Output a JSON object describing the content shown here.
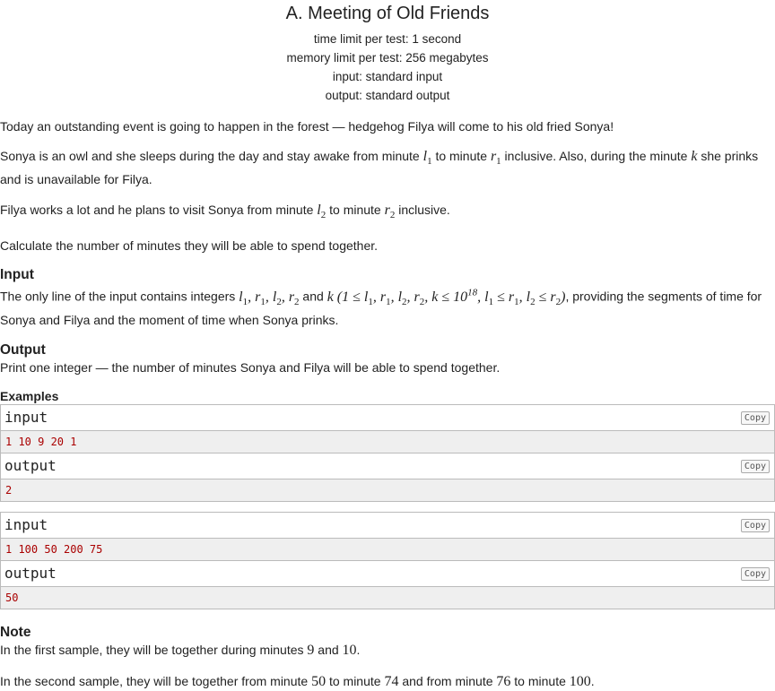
{
  "problem": {
    "title": "A. Meeting of Old Friends",
    "limits": [
      "time limit per test: 1 second",
      "memory limit per test: 256 megabytes",
      "input: standard input",
      "output: standard output"
    ]
  },
  "statement": {
    "p1": "Today an outstanding event is going to happen in the forest — hedgehog Filya will come to his old fried Sonya!",
    "p2": {
      "a": "Sonya is an owl and she sleeps during the day and stay awake from minute ",
      "b": " to minute ",
      "c": " inclusive. Also, during the minute ",
      "d": " she prinks and is unavailable for Filya."
    },
    "p3": {
      "a": "Filya works a lot and he plans to visit Sonya from minute ",
      "b": " to minute ",
      "c": " inclusive."
    },
    "p4": "Calculate the number of minutes they will be able to spend together."
  },
  "input_section": {
    "title": "Input",
    "a": "The only line of the input contains integers ",
    "b": " and ",
    "c": ", providing the segments of time for Sonya and Filya and the moment of time when Sonya prinks."
  },
  "output_section": {
    "title": "Output",
    "text": "Print one integer — the number of minutes Sonya and Filya will be able to spend together."
  },
  "examples": {
    "title": "Examples",
    "copy_label": "Copy",
    "input_label": "input",
    "output_label": "output",
    "ex1_input": "1 10 9 20 1",
    "ex1_output": "2",
    "ex2_input": "1 100 50 200 75",
    "ex2_output": "50"
  },
  "note": {
    "title": "Note",
    "s1": {
      "a": "In the first sample, they will be together during minutes ",
      "n1": "9",
      "b": " and ",
      "n2": "10",
      "c": "."
    },
    "s2": {
      "a": "In the second sample, they will be together from minute ",
      "n1": "50",
      "b": " to minute ",
      "n2": "74",
      "c": " and from minute ",
      "n3": "76",
      "d": " to minute ",
      "n4": "100",
      "e": "."
    }
  }
}
